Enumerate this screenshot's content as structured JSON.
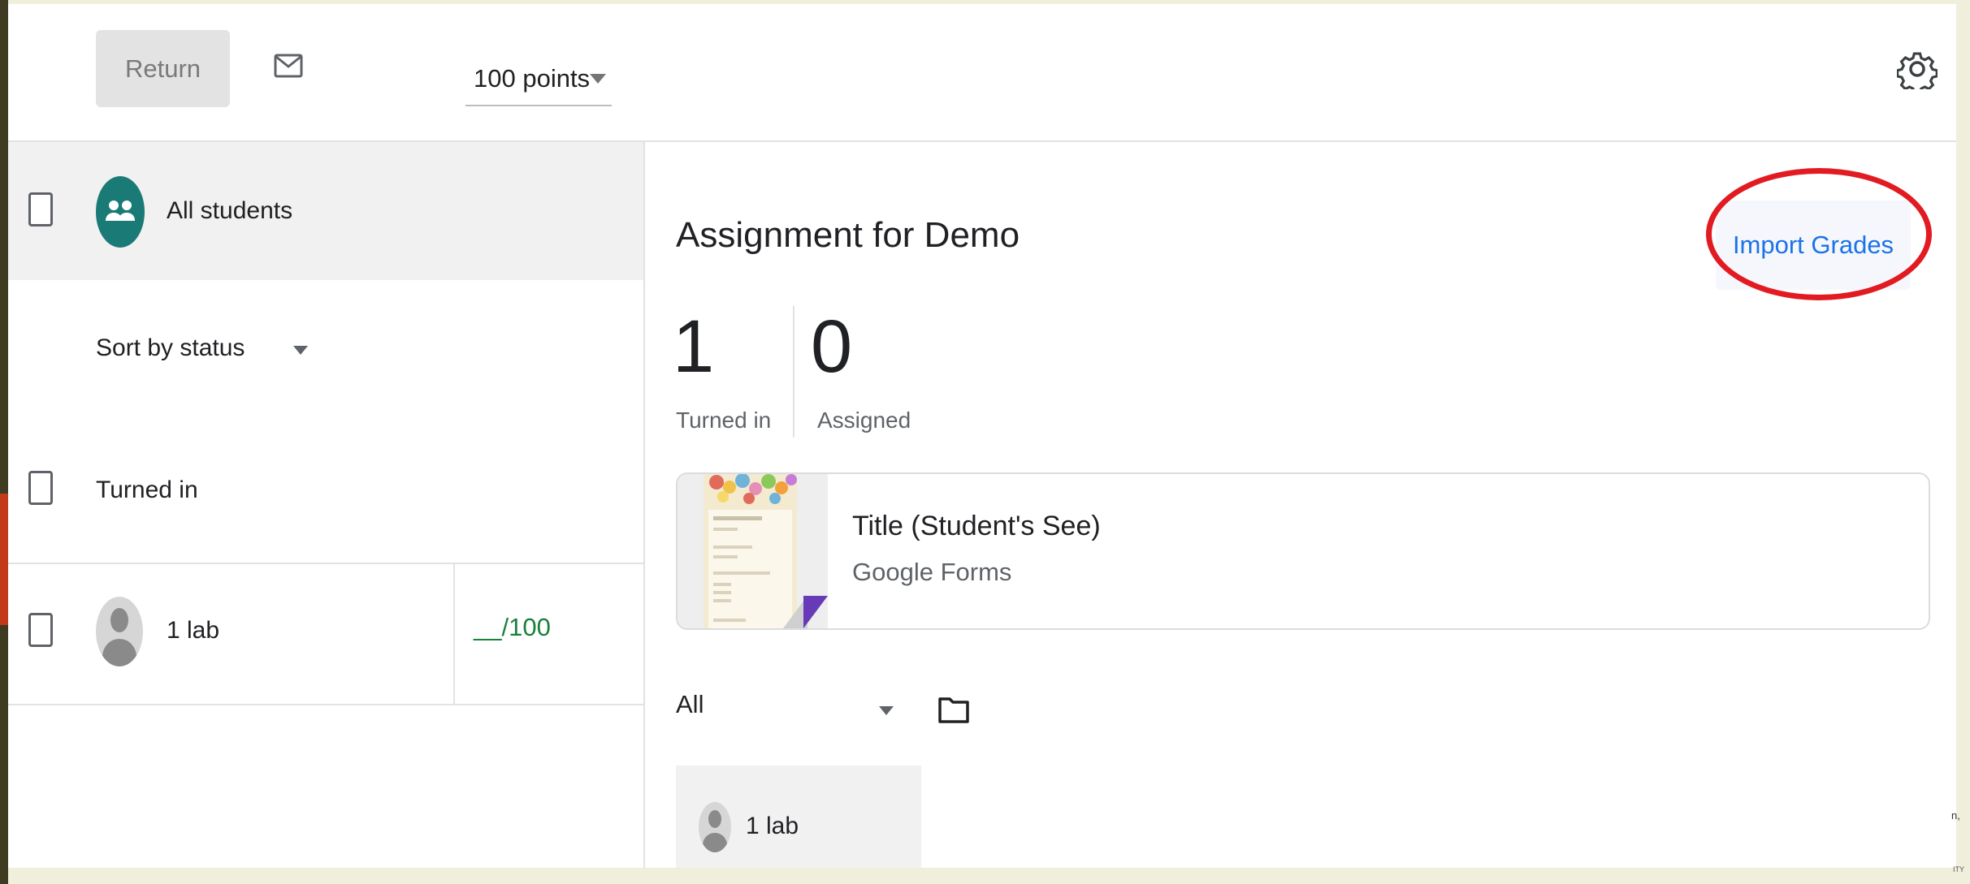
{
  "toolbar": {
    "return_label": "Return",
    "points_value": "100 points"
  },
  "left_panel": {
    "all_students_label": "All students",
    "sort_label": "Sort by status",
    "section_label": "Turned in",
    "students": [
      {
        "name": "1 lab",
        "grade": "__/100"
      }
    ]
  },
  "assignment": {
    "title": "Assignment for Demo",
    "import_label": "Import Grades",
    "turned_in_count": "1",
    "turned_in_label": "Turned in",
    "assigned_count": "0",
    "assigned_label": "Assigned",
    "attachment": {
      "title": "Title (Student's See)",
      "type": "Google Forms"
    },
    "filter_value": "All",
    "tile_student": "1 lab"
  },
  "colors": {
    "accent_blue": "#1a73e8",
    "grade_green": "#188038",
    "highlight_red": "#e21b22",
    "group_teal": "#1a7a75"
  },
  "icons": [
    "mail-icon",
    "gear-icon",
    "group-icon",
    "folder-icon",
    "avatar-icon",
    "dropdown-caret-icon"
  ]
}
